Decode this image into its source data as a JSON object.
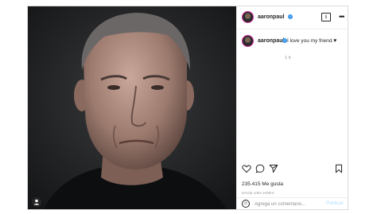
{
  "post": {
    "username": "aaronpaul",
    "caption": "I love you my friend.",
    "caption_emoji": "♥",
    "caption_time": "1 h",
    "likes": "235.415 Me gusta",
    "posted_ago": "HACE UNA HORA",
    "comment_placeholder": "Agrega un comentario...",
    "publish_label": "Publicar"
  },
  "colors": {
    "verified": "#3897f0",
    "publish_disabled": "#b2dffc",
    "avatar_ring": "#d6249f"
  },
  "icons": [
    "verified-icon",
    "download-icon",
    "more-options-icon",
    "heart-icon",
    "comment-icon",
    "share-icon",
    "bookmark-icon",
    "emoji-icon",
    "tag-user-icon"
  ]
}
